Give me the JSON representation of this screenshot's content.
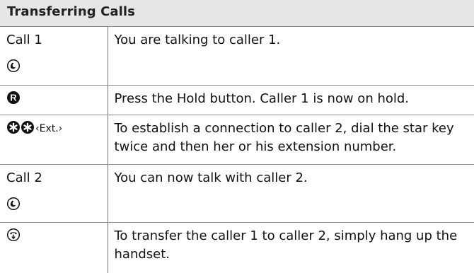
{
  "page": {
    "title": "Transferring Calls"
  },
  "rows": [
    {
      "left_label": "Call 1",
      "left_icon": "handset-offhook-icon",
      "description": "You are talking to caller 1."
    },
    {
      "left_icon": "r-key-icon",
      "description": "Press the Hold button. Caller 1 is now on hold."
    },
    {
      "left_icons": [
        "star-key-icon",
        "star-key-icon"
      ],
      "left_suffix": "‹Ext.›",
      "description": "To establish a connection to caller 2, dial the star key twice and then her or his extension number."
    },
    {
      "left_label": "Call 2",
      "left_icon": "handset-offhook-icon",
      "description": "You can now talk with caller 2."
    },
    {
      "left_icon": "hang-up-icon",
      "description": "To transfer the caller 1 to caller 2, simply hang up the handset."
    }
  ]
}
